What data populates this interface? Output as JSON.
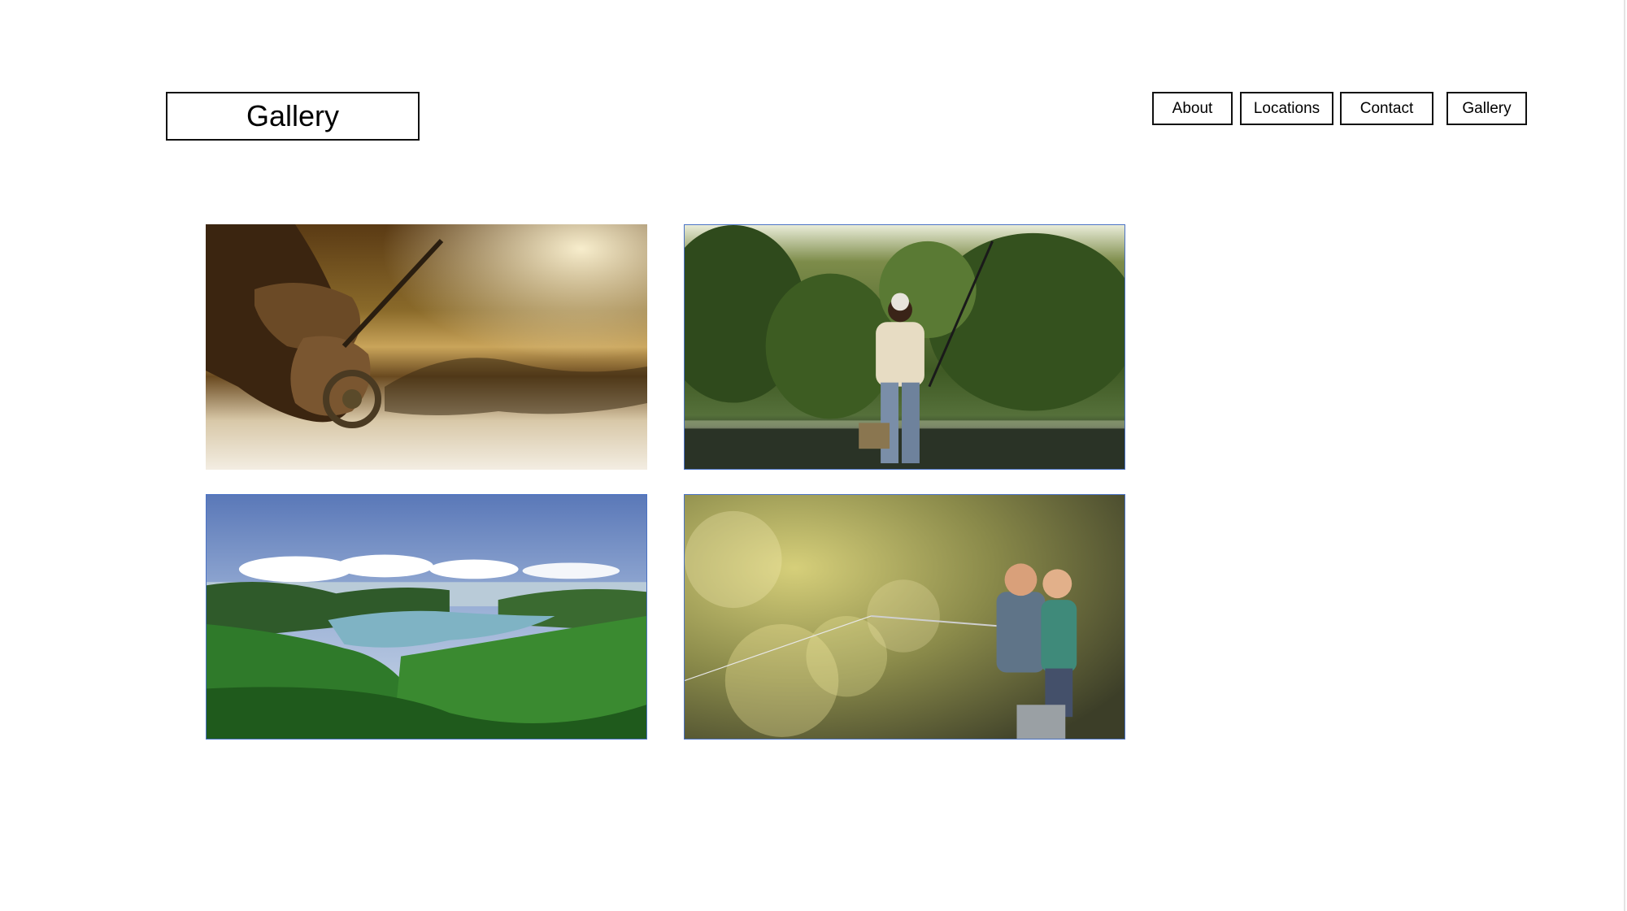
{
  "header": {
    "title": "Gallery"
  },
  "nav": {
    "items": [
      {
        "label": "About"
      },
      {
        "label": "Locations"
      },
      {
        "label": "Contact"
      },
      {
        "label": "Gallery"
      }
    ]
  },
  "gallery": {
    "photos": [
      {
        "subject": "hand holding fly-fishing reel over sunlit water"
      },
      {
        "subject": "smiling older man standing in river with fishing rod and tackle box"
      },
      {
        "subject": "aerial view of green hills surrounding a blue lake under cloudy sky"
      },
      {
        "subject": "man and boy fishing together with bokeh light background"
      }
    ]
  },
  "colors": {
    "border": "#111111",
    "photo_frame": "#4a72c4",
    "background": "#ffffff"
  }
}
